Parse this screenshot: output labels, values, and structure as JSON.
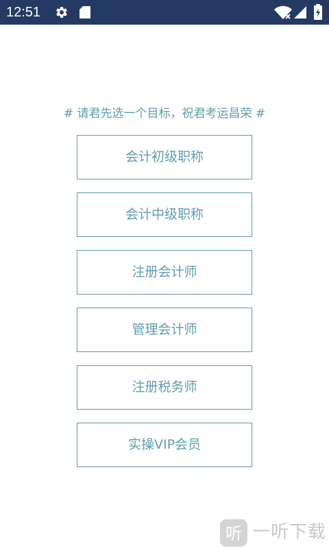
{
  "status_bar": {
    "time": "12:51",
    "background_color": "#243a63",
    "icons": [
      "gear-icon",
      "sd-card-icon",
      "wifi-icon",
      "cellular-signal-icon",
      "battery-icon"
    ]
  },
  "prompt": {
    "text": "# 请君先选一个目标，祝君考运昌荣 #"
  },
  "options": [
    {
      "label": "会计初级职称"
    },
    {
      "label": "会计中级职称"
    },
    {
      "label": "注册会计师"
    },
    {
      "label": "管理会计师"
    },
    {
      "label": "注册税务师"
    },
    {
      "label": "实操VIP会员"
    }
  ],
  "theme": {
    "accent_color": "#5f9eac",
    "border_color": "#5d9aa8"
  },
  "watermark": {
    "logo_glyph": "听",
    "text": "一听下载"
  }
}
